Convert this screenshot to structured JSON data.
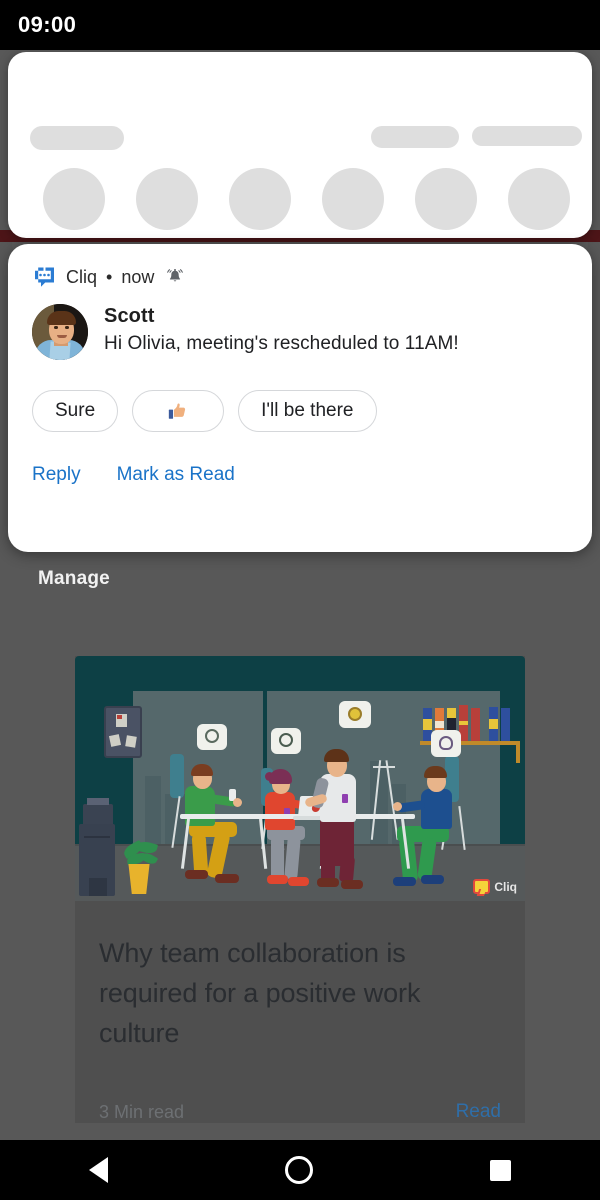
{
  "status_bar": {
    "time": "09:00"
  },
  "quick_settings": {
    "skeleton_bars": 3,
    "skeleton_tiles": 6,
    "handle": "drag-handle"
  },
  "notification": {
    "app_name": "Cliq",
    "separator": "•",
    "time": "now",
    "app_icon": "cliq-chat-icon",
    "alert_icon": "bell-ringing-icon",
    "sender": "Scott",
    "sender_avatar": "avatar-photo",
    "message": "Hi Olivia, meeting's rescheduled to 11AM!",
    "smart_replies": [
      {
        "label": "Sure",
        "icon": null
      },
      {
        "label": "",
        "icon": "thumbs-up-emoji"
      },
      {
        "label": "I'll be there",
        "icon": null
      }
    ],
    "actions": [
      {
        "label": "Reply"
      },
      {
        "label": "Mark as Read"
      }
    ],
    "action_color": "#1a73c8"
  },
  "shade": {
    "manage_label": "Manage"
  },
  "background_app": {
    "article": {
      "illustration": "team-collaboration-office-illustration",
      "illustration_bg_color": "#0d4045",
      "watermark": "Cliq",
      "title": "Why team collaboration is required for a positive work culture",
      "read_time": "3 Min read",
      "read_link": "Read",
      "read_link_color": "#2f6ea8"
    }
  },
  "nav_bar": {
    "back": "back-triangle-icon",
    "home": "home-circle-icon",
    "recents": "recents-square-icon"
  }
}
